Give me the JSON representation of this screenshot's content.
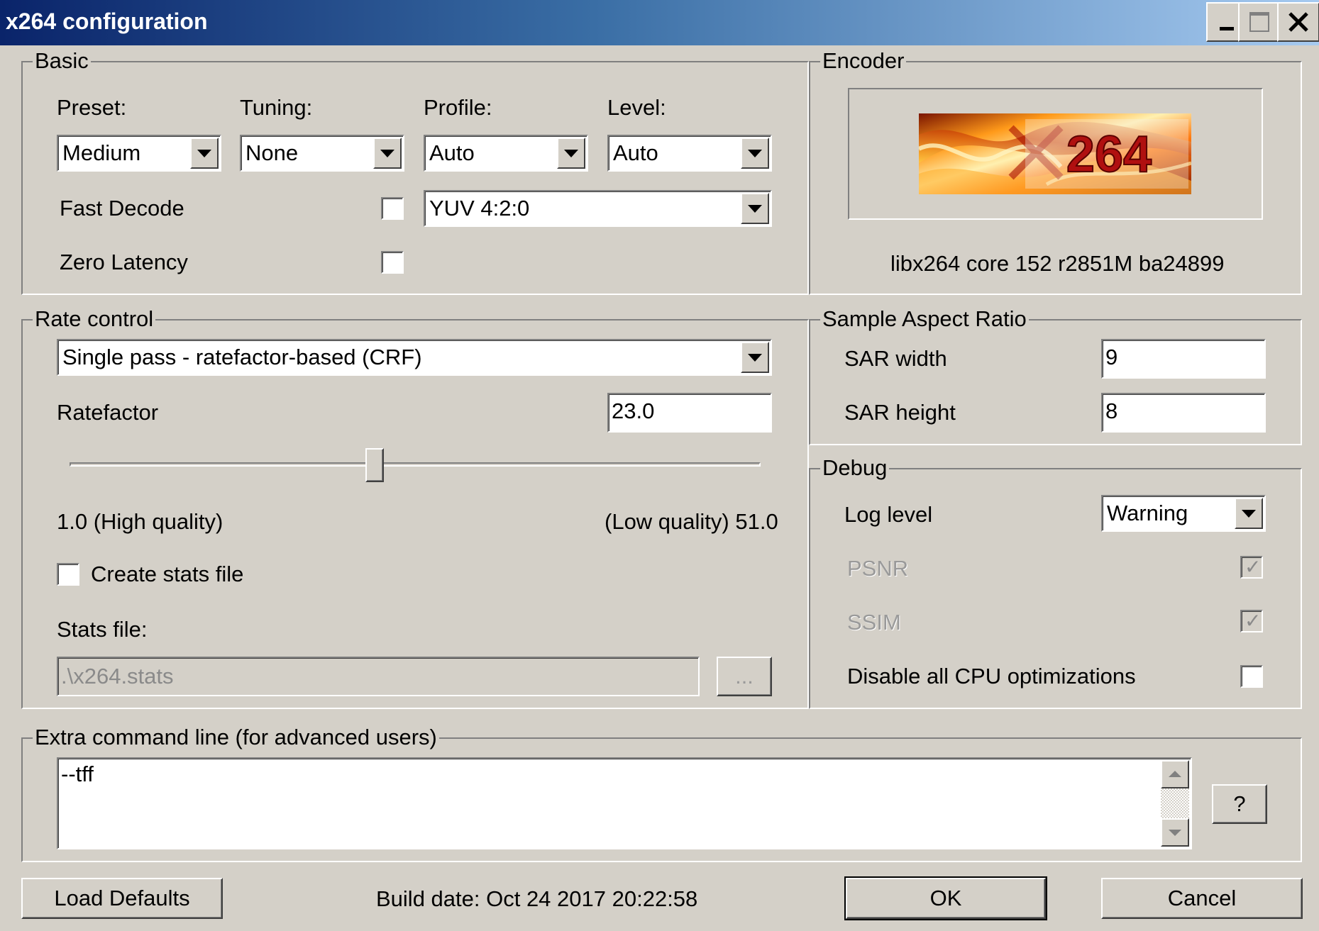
{
  "window": {
    "title": "x264 configuration"
  },
  "basic": {
    "legend": "Basic",
    "preset_label": "Preset:",
    "tuning_label": "Tuning:",
    "profile_label": "Profile:",
    "level_label": "Level:",
    "preset_value": "Medium",
    "tuning_value": "None",
    "profile_value": "Auto",
    "level_value": "Auto",
    "fast_decode_label": "Fast Decode",
    "zero_latency_label": "Zero Latency",
    "colorspace_value": "YUV 4:2:0",
    "fast_decode_checked": false,
    "zero_latency_checked": false
  },
  "encoder": {
    "legend": "Encoder",
    "logo_text": "264",
    "version": "libx264 core 152 r2851M ba24899"
  },
  "rate_control": {
    "legend": "Rate control",
    "mode_value": "Single pass - ratefactor-based (CRF)",
    "ratefactor_label": "Ratefactor",
    "ratefactor_value": "23.0",
    "slider_min": 1.0,
    "slider_max": 51.0,
    "slider_value": 23.0,
    "min_label": "1.0 (High quality)",
    "max_label": "(Low quality) 51.0",
    "create_stats_label": "Create stats file",
    "create_stats_checked": false,
    "stats_file_label": "Stats file:",
    "stats_file_value": ".\\x264.stats",
    "browse_label": "..."
  },
  "sar": {
    "legend": "Sample Aspect Ratio",
    "width_label": "SAR width",
    "width_value": "9",
    "height_label": "SAR height",
    "height_value": "8"
  },
  "debug": {
    "legend": "Debug",
    "log_level_label": "Log level",
    "log_level_value": "Warning",
    "psnr_label": "PSNR",
    "psnr_checked": true,
    "ssim_label": "SSIM",
    "ssim_checked": true,
    "disable_cpu_label": "Disable all CPU optimizations",
    "disable_cpu_checked": false
  },
  "extra": {
    "legend": "Extra command line (for advanced users)",
    "value": "--tff",
    "help_label": "?"
  },
  "footer": {
    "load_defaults_label": "Load Defaults",
    "build_date": "Build date: Oct 24 2017 20:22:58",
    "ok_label": "OK",
    "cancel_label": "Cancel"
  },
  "colors": {
    "face": "#d4d0c8",
    "title_start": "#0a246a",
    "title_end": "#a6caf0"
  }
}
